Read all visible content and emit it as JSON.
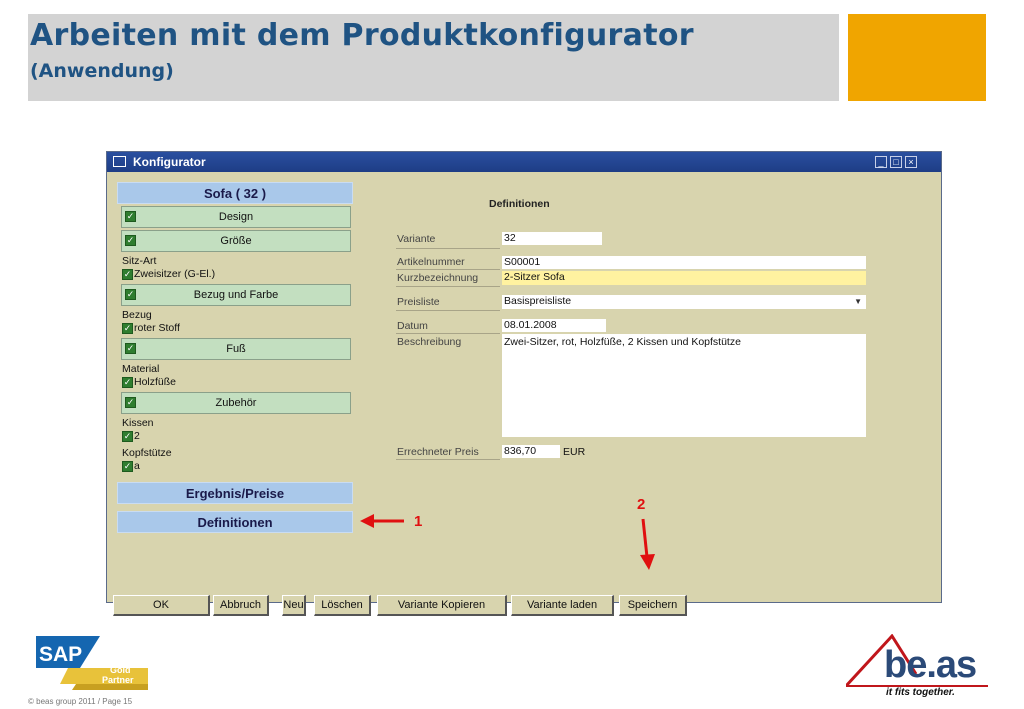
{
  "slide": {
    "title": "Arbeiten mit dem Produktkonfigurator",
    "subtitle": "(Anwendung)",
    "copyright": "© beas group 2011 / Page 15"
  },
  "window": {
    "title": "Konfigurator",
    "controls": [
      "minimize-icon",
      "maximize-icon",
      "close-icon"
    ]
  },
  "left": {
    "header": "Sofa  ( 32 )",
    "sections": {
      "design": "Design",
      "groesse": "Größe",
      "bezug_farbe": "Bezug und Farbe",
      "fuss": "Fuß",
      "zubehoer": "Zubehör"
    },
    "attrs": {
      "sitzart_label": "Sitz-Art",
      "sitzart_value": "Zweisitzer (G-El.)",
      "bezug_label": "Bezug",
      "bezug_value": "roter Stoff",
      "material_label": "Material",
      "material_value": "Holzfüße",
      "kissen_label": "Kissen",
      "kissen_value": "2",
      "kopf_label": "Kopfstütze",
      "kopf_value": "a"
    },
    "ergebnis": "Ergebnis/Preise",
    "definitionen": "Definitionen"
  },
  "form": {
    "title": "Definitionen",
    "variante_label": "Variante",
    "variante_value": "32",
    "artikel_label": "Artikelnummer",
    "artikel_value": "S00001",
    "kurz_label": "Kurzbezeichnung",
    "kurz_value": "2-Sitzer Sofa",
    "preisliste_label": "Preisliste",
    "preisliste_value": "Basispreisliste",
    "datum_label": "Datum",
    "datum_value": "08.01.2008",
    "beschreibung_label": "Beschreibung",
    "beschreibung_value": "Zwei-Sitzer, rot, Holzfüße, 2 Kissen und Kopfstütze",
    "preis_label": "Errechneter Preis",
    "preis_value": "836,70",
    "currency": "EUR"
  },
  "buttons": {
    "ok": "OK",
    "abbruch": "Abbruch",
    "neu": "Neu",
    "loeschen": "Löschen",
    "kopieren": "Variante Kopieren",
    "laden": "Variante laden",
    "speichern": "Speichern"
  },
  "annotations": {
    "one": "1",
    "two": "2"
  },
  "logos": {
    "sap_main": "SAP",
    "sap_gold": "Gold",
    "sap_partner": "Partner",
    "beas": "be.as",
    "beas_tagline": "it fits together."
  },
  "colors": {
    "title_blue": "#1f5383",
    "accent_orange": "#f0a500",
    "annotation_red": "#e01010",
    "field_highlight": "#fff2a0"
  }
}
